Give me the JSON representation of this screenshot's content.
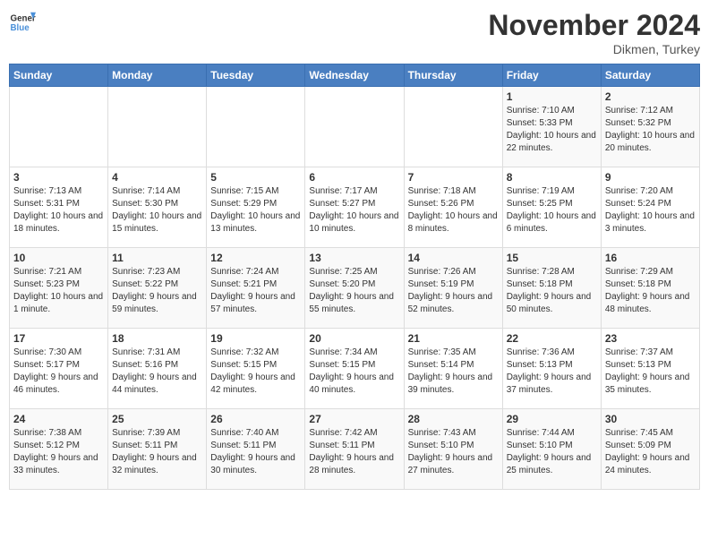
{
  "header": {
    "logo_line1": "General",
    "logo_line2": "Blue",
    "month": "November 2024",
    "location": "Dikmen, Turkey"
  },
  "days_of_week": [
    "Sunday",
    "Monday",
    "Tuesday",
    "Wednesday",
    "Thursday",
    "Friday",
    "Saturday"
  ],
  "weeks": [
    [
      {
        "num": "",
        "info": ""
      },
      {
        "num": "",
        "info": ""
      },
      {
        "num": "",
        "info": ""
      },
      {
        "num": "",
        "info": ""
      },
      {
        "num": "",
        "info": ""
      },
      {
        "num": "1",
        "info": "Sunrise: 7:10 AM\nSunset: 5:33 PM\nDaylight: 10 hours and 22 minutes."
      },
      {
        "num": "2",
        "info": "Sunrise: 7:12 AM\nSunset: 5:32 PM\nDaylight: 10 hours and 20 minutes."
      }
    ],
    [
      {
        "num": "3",
        "info": "Sunrise: 7:13 AM\nSunset: 5:31 PM\nDaylight: 10 hours and 18 minutes."
      },
      {
        "num": "4",
        "info": "Sunrise: 7:14 AM\nSunset: 5:30 PM\nDaylight: 10 hours and 15 minutes."
      },
      {
        "num": "5",
        "info": "Sunrise: 7:15 AM\nSunset: 5:29 PM\nDaylight: 10 hours and 13 minutes."
      },
      {
        "num": "6",
        "info": "Sunrise: 7:17 AM\nSunset: 5:27 PM\nDaylight: 10 hours and 10 minutes."
      },
      {
        "num": "7",
        "info": "Sunrise: 7:18 AM\nSunset: 5:26 PM\nDaylight: 10 hours and 8 minutes."
      },
      {
        "num": "8",
        "info": "Sunrise: 7:19 AM\nSunset: 5:25 PM\nDaylight: 10 hours and 6 minutes."
      },
      {
        "num": "9",
        "info": "Sunrise: 7:20 AM\nSunset: 5:24 PM\nDaylight: 10 hours and 3 minutes."
      }
    ],
    [
      {
        "num": "10",
        "info": "Sunrise: 7:21 AM\nSunset: 5:23 PM\nDaylight: 10 hours and 1 minute."
      },
      {
        "num": "11",
        "info": "Sunrise: 7:23 AM\nSunset: 5:22 PM\nDaylight: 9 hours and 59 minutes."
      },
      {
        "num": "12",
        "info": "Sunrise: 7:24 AM\nSunset: 5:21 PM\nDaylight: 9 hours and 57 minutes."
      },
      {
        "num": "13",
        "info": "Sunrise: 7:25 AM\nSunset: 5:20 PM\nDaylight: 9 hours and 55 minutes."
      },
      {
        "num": "14",
        "info": "Sunrise: 7:26 AM\nSunset: 5:19 PM\nDaylight: 9 hours and 52 minutes."
      },
      {
        "num": "15",
        "info": "Sunrise: 7:28 AM\nSunset: 5:18 PM\nDaylight: 9 hours and 50 minutes."
      },
      {
        "num": "16",
        "info": "Sunrise: 7:29 AM\nSunset: 5:18 PM\nDaylight: 9 hours and 48 minutes."
      }
    ],
    [
      {
        "num": "17",
        "info": "Sunrise: 7:30 AM\nSunset: 5:17 PM\nDaylight: 9 hours and 46 minutes."
      },
      {
        "num": "18",
        "info": "Sunrise: 7:31 AM\nSunset: 5:16 PM\nDaylight: 9 hours and 44 minutes."
      },
      {
        "num": "19",
        "info": "Sunrise: 7:32 AM\nSunset: 5:15 PM\nDaylight: 9 hours and 42 minutes."
      },
      {
        "num": "20",
        "info": "Sunrise: 7:34 AM\nSunset: 5:15 PM\nDaylight: 9 hours and 40 minutes."
      },
      {
        "num": "21",
        "info": "Sunrise: 7:35 AM\nSunset: 5:14 PM\nDaylight: 9 hours and 39 minutes."
      },
      {
        "num": "22",
        "info": "Sunrise: 7:36 AM\nSunset: 5:13 PM\nDaylight: 9 hours and 37 minutes."
      },
      {
        "num": "23",
        "info": "Sunrise: 7:37 AM\nSunset: 5:13 PM\nDaylight: 9 hours and 35 minutes."
      }
    ],
    [
      {
        "num": "24",
        "info": "Sunrise: 7:38 AM\nSunset: 5:12 PM\nDaylight: 9 hours and 33 minutes."
      },
      {
        "num": "25",
        "info": "Sunrise: 7:39 AM\nSunset: 5:11 PM\nDaylight: 9 hours and 32 minutes."
      },
      {
        "num": "26",
        "info": "Sunrise: 7:40 AM\nSunset: 5:11 PM\nDaylight: 9 hours and 30 minutes."
      },
      {
        "num": "27",
        "info": "Sunrise: 7:42 AM\nSunset: 5:11 PM\nDaylight: 9 hours and 28 minutes."
      },
      {
        "num": "28",
        "info": "Sunrise: 7:43 AM\nSunset: 5:10 PM\nDaylight: 9 hours and 27 minutes."
      },
      {
        "num": "29",
        "info": "Sunrise: 7:44 AM\nSunset: 5:10 PM\nDaylight: 9 hours and 25 minutes."
      },
      {
        "num": "30",
        "info": "Sunrise: 7:45 AM\nSunset: 5:09 PM\nDaylight: 9 hours and 24 minutes."
      }
    ]
  ]
}
